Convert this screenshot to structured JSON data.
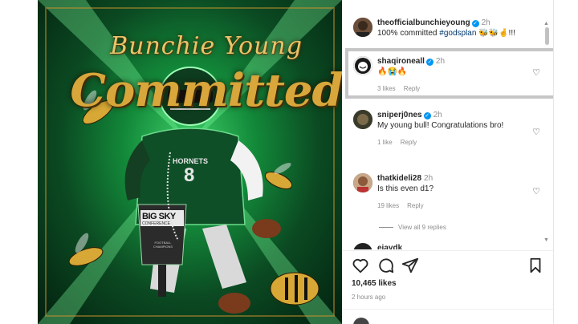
{
  "post_media": {
    "script_line_1": "Bunchie Young",
    "script_line_2": "Committed",
    "jersey_team": "HORNETS",
    "jersey_number": "8",
    "trophy_brand": "BIG SKY",
    "trophy_sub": "CONFERENCE",
    "trophy_plate": "FOOTBALL CHAMPIONS"
  },
  "caption": {
    "username": "theofficialbunchieyoung",
    "time": "2h",
    "text": "100% committed ",
    "hashtag": "#godsplan",
    "emoji": "🐝🐝🤞!!!"
  },
  "comments": [
    {
      "username": "shaqironeall",
      "time": "2h",
      "text": "🔥😭🔥",
      "likes": "3 likes",
      "reply": "Reply"
    },
    {
      "username": "sniperj0nes",
      "time": "2h",
      "text": "My young bull! Congratulations bro!",
      "likes": "1 like",
      "reply": "Reply"
    },
    {
      "username": "thatkideli28",
      "time": "2h",
      "text": "Is this even d1?",
      "likes": "19 likes",
      "reply": "Reply"
    }
  ],
  "view_replies": "View all 9 replies",
  "partial_next_user": "eiaydk",
  "like_count": "10,465 likes",
  "posted_ago": "2 hours ago",
  "icons": [
    "heart-icon",
    "comment-icon",
    "share-icon",
    "bookmark-icon",
    "verified-badge-icon",
    "scroll-arrow-icon"
  ],
  "colors": {
    "verified": "#0095f6",
    "hashtag": "#00376b",
    "muted": "#8e8e8e",
    "highlight_border": "#c6c6c6"
  }
}
